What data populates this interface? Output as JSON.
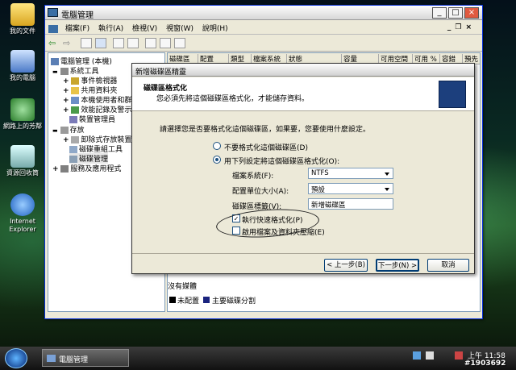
{
  "desktop": {
    "icons": [
      "我的文件",
      "我的電腦",
      "網路上的芳鄰",
      "資源回收筒",
      "Internet Explorer"
    ]
  },
  "window": {
    "title": "電腦管理",
    "menu": [
      "檔案(F)",
      "執行(A)",
      "檢視(V)",
      "視窗(W)",
      "說明(H)"
    ],
    "controls": {
      "min": "_",
      "max": "□",
      "close": "×"
    },
    "child_controls": {
      "min": "_",
      "max": "❐",
      "close": "×"
    }
  },
  "tree": {
    "root": "電腦管理 (本機)",
    "items": [
      {
        "label": "系統工具",
        "level": 1,
        "expander": "▬"
      },
      {
        "label": "事件檢視器",
        "level": 2,
        "expander": "+"
      },
      {
        "label": "共用資料夾",
        "level": 2,
        "expander": "+"
      },
      {
        "label": "本機使用者和群組",
        "level": 2,
        "expander": "+"
      },
      {
        "label": "效能記錄及警示",
        "level": 2,
        "expander": "+"
      },
      {
        "label": "裝置管理員",
        "level": 2,
        "expander": ""
      },
      {
        "label": "存放",
        "level": 1,
        "expander": "▬"
      },
      {
        "label": "卸除式存放裝置",
        "level": 2,
        "expander": "+"
      },
      {
        "label": "磁碟重組工具",
        "level": 2,
        "expander": ""
      },
      {
        "label": "磁碟管理",
        "level": 2,
        "expander": ""
      },
      {
        "label": "服務及應用程式",
        "level": 1,
        "expander": "+"
      }
    ]
  },
  "columns": [
    "磁碟區",
    "配置",
    "類型",
    "檔案系統",
    "狀態",
    "容量",
    "可用空間",
    "可用 %",
    "容錯",
    "預先"
  ],
  "pane": {
    "disk_label": "沒有媒體",
    "legend": [
      "未配置",
      "主要磁碟分割"
    ],
    "legend_colors": [
      "#000000",
      "#1a237e"
    ]
  },
  "dialog": {
    "title": "新增磁碟區精靈",
    "header_title": "磁碟區格式化",
    "header_sub": "您必須先將這個磁碟區格式化，才能儲存資料。",
    "prompt": "請選擇您是否要格式化這個磁碟區，如果要，您要使用什麼設定。",
    "radio_no": "不要格式化這個磁碟區(D)",
    "radio_yes": "用下列設定將這個磁碟區格式化(O):",
    "fs_label": "檔案系統(F):",
    "fs_value": "NTFS",
    "alloc_label": "配置單位大小(A):",
    "alloc_value": "預設",
    "vol_label": "磁碟區標籤(V):",
    "vol_value": "新增磁碟區",
    "quick_format": "執行快速格式化(P)",
    "compress": "啟用檔案及資料夾壓縮(E)",
    "back": "< 上一步(B)",
    "next": "下一步(N) >",
    "cancel": "取消"
  },
  "taskbar": {
    "task": "電腦管理",
    "clock": "上午 11:58",
    "watermark": "#1903692"
  },
  "colors": {
    "titlebar": "#e8e8e8",
    "dialog_bg": "#ece9d8",
    "desktop": "#0a2a22"
  }
}
